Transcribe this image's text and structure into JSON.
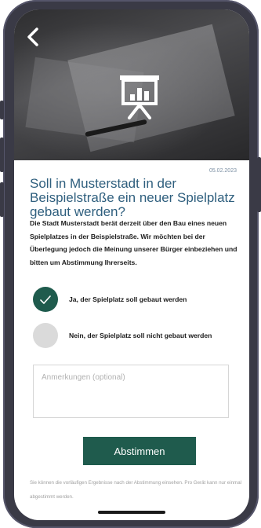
{
  "header": {
    "back_icon": "chevron-left-icon",
    "hero_icon": "presentation-chart-icon"
  },
  "poll": {
    "date": "05.02.2023",
    "question": "Soll in Musterstadt in der Beispielstraße ein neuer Spielplatz gebaut werden?",
    "description": "Die Stadt Musterstadt berät derzeit über den Bau eines neuen Spielplatzes in der Beispielstraße. Wir möchten bei der Überlegung jedoch die Meinung unserer Bürger einbeziehen und bitten um Abstimmung Ihrerseits.",
    "options": [
      {
        "label": "Ja, der Spielplatz soll gebaut werden",
        "selected": true
      },
      {
        "label": "Nein, der Spielplatz soll nicht gebaut werden",
        "selected": false
      }
    ],
    "notes_placeholder": "Anmerkungen (optional)",
    "vote_label": "Abstimmen",
    "info_text": "Sie können die vorläufigen Ergebnisse nach der Abstimmung einsehen. Pro Gerät kann nur einmal abgestimmt werden."
  },
  "colors": {
    "accent": "#1f5b4d",
    "question": "#2f5f7e",
    "date": "#7b8fa3",
    "unselected": "#dadada"
  }
}
